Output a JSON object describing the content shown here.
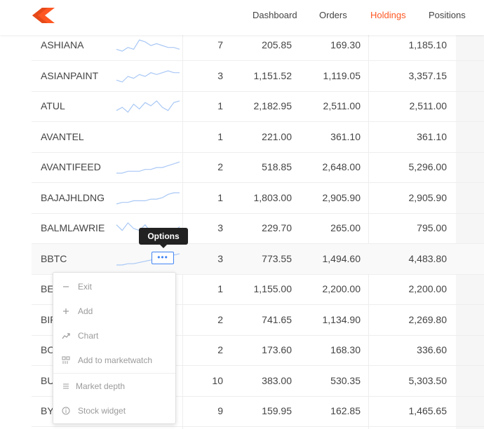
{
  "nav": {
    "brand_color": "#ff5722",
    "items": [
      {
        "label": "Dashboard",
        "active": false
      },
      {
        "label": "Orders",
        "active": false
      },
      {
        "label": "Holdings",
        "active": true
      },
      {
        "label": "Positions",
        "active": false
      }
    ]
  },
  "holdings": {
    "rows": [
      {
        "symbol": "ASHIANA",
        "qty": "7",
        "avg": "205.85",
        "ltp": "169.30",
        "cur_val": "1,185.10",
        "spark": [
          5,
          4,
          6,
          5,
          10,
          9,
          7,
          8,
          7,
          6,
          6,
          5
        ]
      },
      {
        "symbol": "ASIANPAINT",
        "qty": "3",
        "avg": "1,151.52",
        "ltp": "1,119.05",
        "cur_val": "3,357.15",
        "spark": [
          4,
          3,
          6,
          5,
          7,
          6,
          8,
          7,
          8,
          9,
          8,
          8
        ]
      },
      {
        "symbol": "ATUL",
        "qty": "1",
        "avg": "2,182.95",
        "ltp": "2,511.00",
        "cur_val": "2,511.00",
        "spark": [
          4,
          6,
          3,
          8,
          5,
          9,
          7,
          10,
          6,
          4,
          9,
          10
        ]
      },
      {
        "symbol": "AVANTEL",
        "qty": "1",
        "avg": "221.00",
        "ltp": "361.10",
        "cur_val": "361.10",
        "spark": []
      },
      {
        "symbol": "AVANTIFEED",
        "qty": "2",
        "avg": "518.85",
        "ltp": "2,648.00",
        "cur_val": "5,296.00",
        "spark": [
          2,
          2,
          3,
          3,
          3,
          4,
          4,
          5,
          5,
          6,
          7,
          8
        ]
      },
      {
        "symbol": "BAJAJHLDNG",
        "qty": "1",
        "avg": "1,803.00",
        "ltp": "2,905.90",
        "cur_val": "2,905.90",
        "spark": [
          2,
          3,
          3,
          4,
          4,
          4,
          5,
          5,
          6,
          8,
          9,
          9
        ]
      },
      {
        "symbol": "BALMLAWRIE",
        "qty": "3",
        "avg": "229.70",
        "ltp": "265.00",
        "cur_val": "795.00",
        "spark": [
          8,
          5,
          9,
          6,
          5,
          8,
          4,
          6,
          5,
          3,
          4,
          7
        ]
      },
      {
        "symbol": "BBTC",
        "qty": "3",
        "avg": "773.55",
        "ltp": "1,494.60",
        "cur_val": "4,483.80",
        "spark": [
          2,
          2,
          3,
          3,
          4,
          5,
          6,
          7,
          8,
          9,
          10,
          11
        ]
      },
      {
        "symbol": "BE",
        "qty": "1",
        "avg": "1,155.00",
        "ltp": "2,200.00",
        "cur_val": "2,200.00",
        "spark": []
      },
      {
        "symbol": "BIF",
        "qty": "2",
        "avg": "741.65",
        "ltp": "1,134.90",
        "cur_val": "2,269.80",
        "spark": []
      },
      {
        "symbol": "BO",
        "qty": "2",
        "avg": "173.60",
        "ltp": "168.30",
        "cur_val": "336.60",
        "spark": []
      },
      {
        "symbol": "BU",
        "qty": "10",
        "avg": "383.00",
        "ltp": "530.35",
        "cur_val": "5,303.50",
        "spark": []
      },
      {
        "symbol": "BY",
        "qty": "9",
        "avg": "159.95",
        "ltp": "162.85",
        "cur_val": "1,465.65",
        "spark": []
      }
    ]
  },
  "options_button": {
    "label": "•••",
    "tooltip": "Options"
  },
  "menu": {
    "items": [
      {
        "label": "Exit",
        "icon": "minus-icon"
      },
      {
        "label": "Add",
        "icon": "plus-icon"
      },
      {
        "label": "Chart",
        "icon": "trend-chart-icon"
      },
      {
        "label": "Add to marketwatch",
        "icon": "marketwatch-icon"
      },
      {
        "label": "Market depth",
        "icon": "market-depth-icon"
      },
      {
        "label": "Stock widget",
        "icon": "info-icon"
      }
    ]
  }
}
